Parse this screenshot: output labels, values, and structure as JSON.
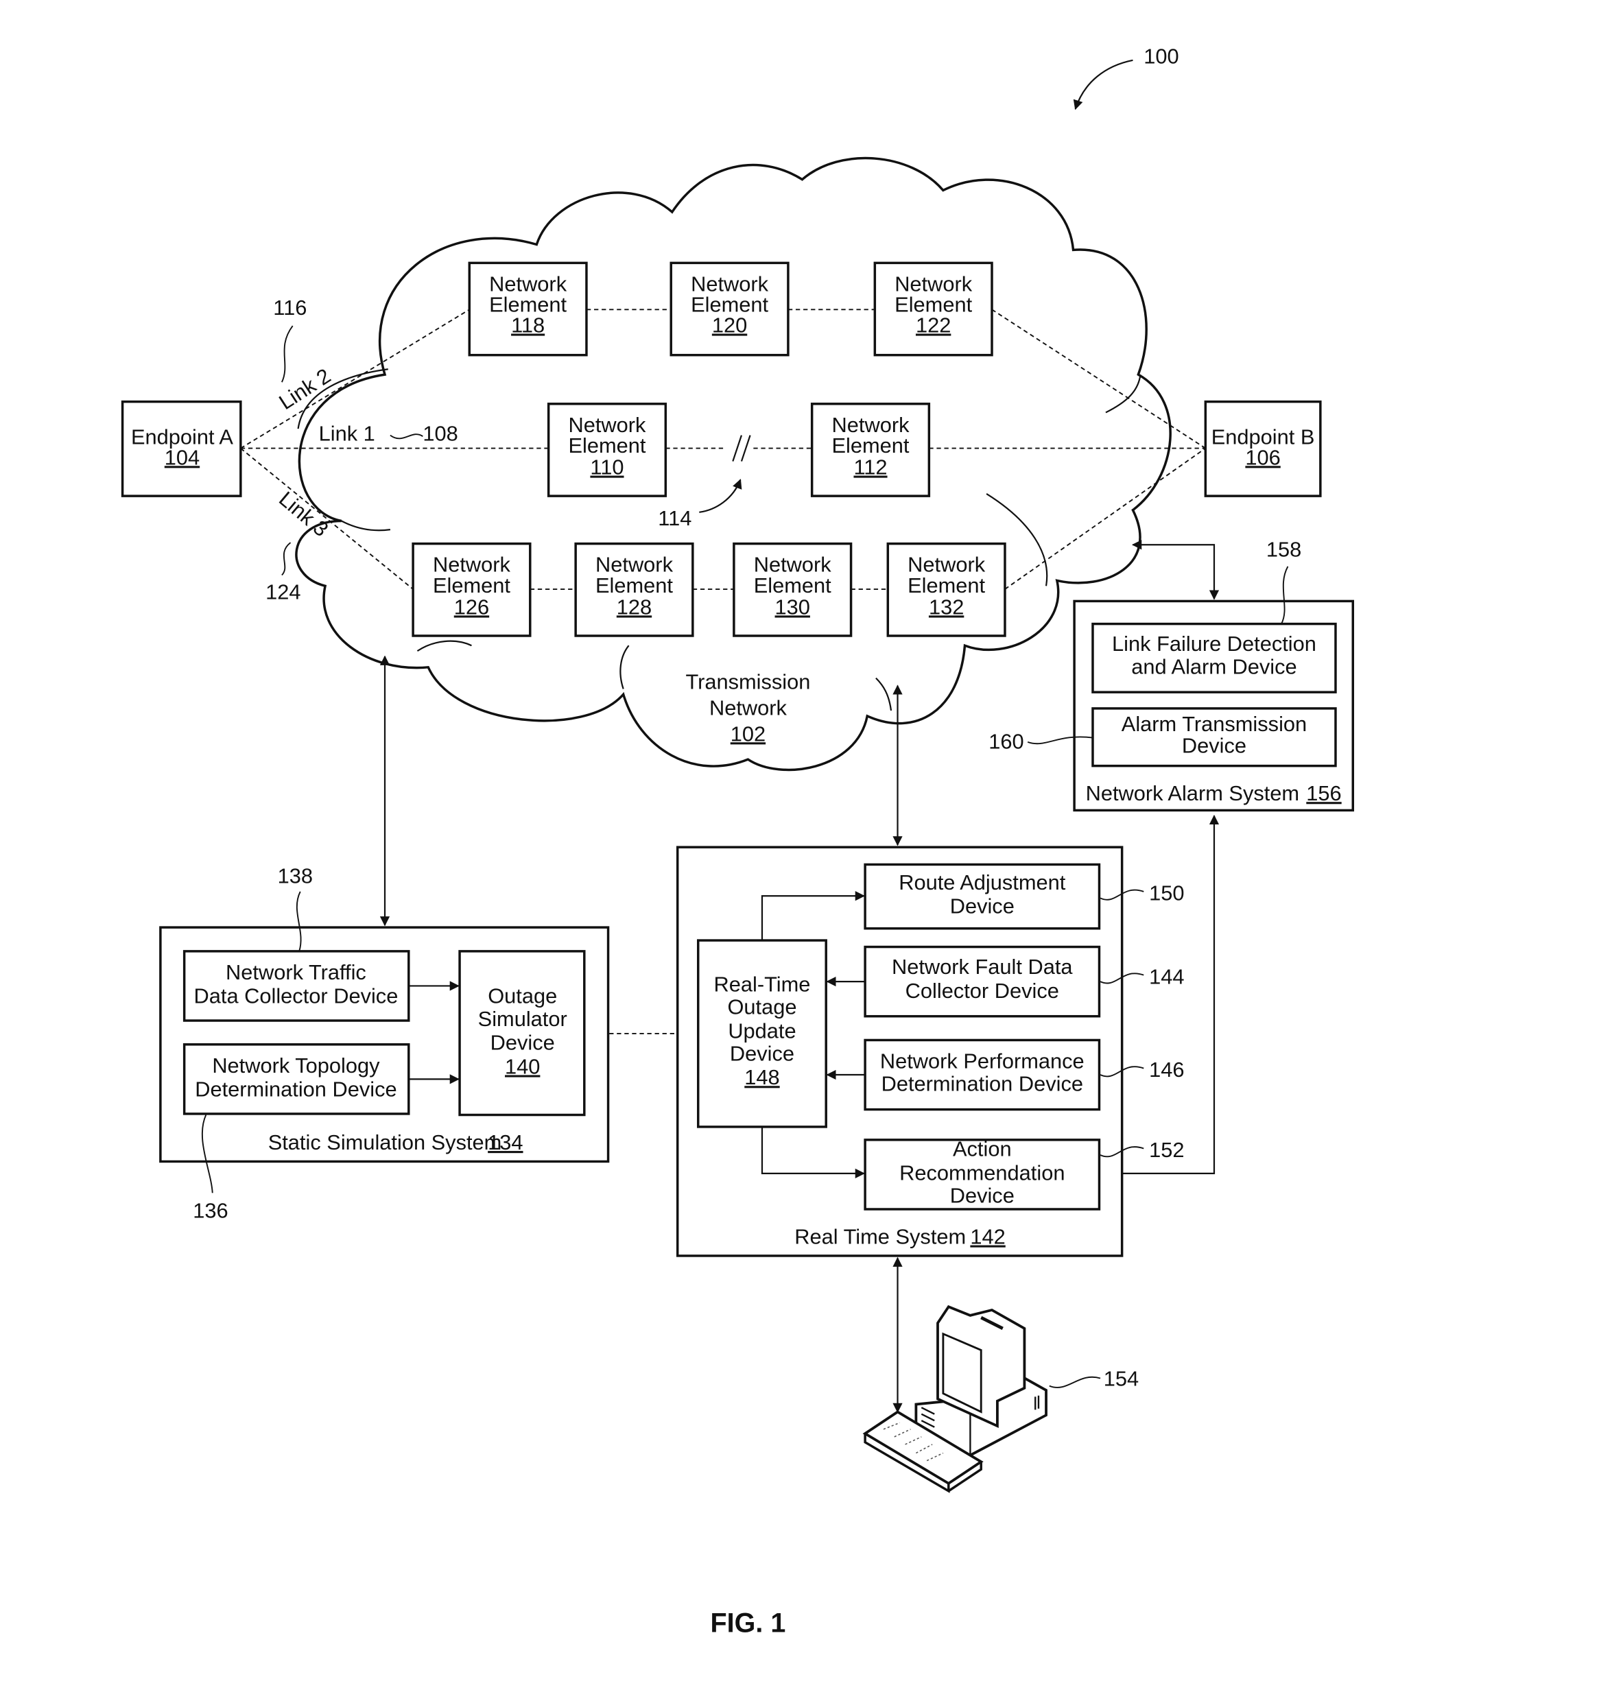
{
  "figure": {
    "title": "FIG. 1",
    "ref_system": "100"
  },
  "network": {
    "label_line1": "Transmission",
    "label_line2": "Network",
    "ref": "102",
    "break_ref": "114"
  },
  "endpoints": {
    "a": {
      "label": "Endpoint A",
      "ref": "104"
    },
    "b": {
      "label": "Endpoint B",
      "ref": "106"
    }
  },
  "links": {
    "link1": {
      "label": "Link 1",
      "ref": "108"
    },
    "link2": {
      "label": "Link 2",
      "ref": "116"
    },
    "link3": {
      "label": "Link 3",
      "ref": "124"
    }
  },
  "elements": {
    "line1": "Network",
    "line2": "Element",
    "ne110": "110",
    "ne112": "112",
    "ne118": "118",
    "ne120": "120",
    "ne122": "122",
    "ne126": "126",
    "ne128": "128",
    "ne130": "130",
    "ne132": "132"
  },
  "static_system": {
    "label": "Static Simulation System",
    "ref": "134",
    "traffic": {
      "line1": "Network Traffic",
      "line2": "Data Collector Device",
      "ref": "138"
    },
    "topology": {
      "line1": "Network Topology",
      "line2": "Determination Device",
      "ref": "136"
    },
    "simulator": {
      "line1": "Outage",
      "line2": "Simulator",
      "line3": "Device",
      "ref": "140"
    }
  },
  "realtime_system": {
    "label": "Real Time System",
    "ref": "142",
    "update": {
      "line1": "Real-Time",
      "line2": "Outage",
      "line3": "Update",
      "line4": "Device",
      "ref": "148"
    },
    "route": {
      "line1": "Route Adjustment",
      "line2": "Device",
      "ref": "150"
    },
    "fault": {
      "line1": "Network Fault Data",
      "line2": "Collector Device",
      "ref": "144"
    },
    "performance": {
      "line1": "Network Performance",
      "line2": "Determination Device",
      "ref": "146"
    },
    "action": {
      "line1": "Action",
      "line2": "Recommendation",
      "line3": "Device",
      "ref": "152"
    }
  },
  "alarm_system": {
    "label": "Network Alarm System",
    "ref": "156",
    "detection": {
      "line1": "Link Failure Detection",
      "line2": "and Alarm Device",
      "ref": "158"
    },
    "transmission": {
      "line1": "Alarm Transmission",
      "line2": "Device",
      "ref": "160"
    }
  },
  "computer": {
    "ref": "154"
  }
}
